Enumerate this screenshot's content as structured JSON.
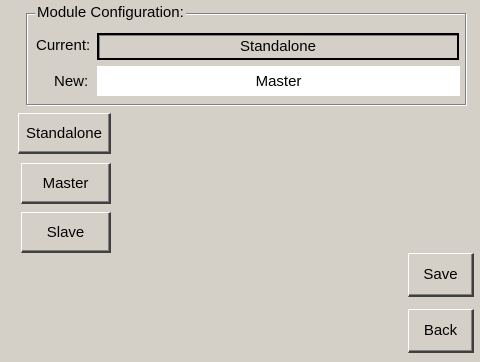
{
  "module_config": {
    "group_title": "Module Configuration:",
    "current_label": "Current:",
    "current_value": "Standalone",
    "new_label": "New:",
    "new_value": "Master"
  },
  "mode_buttons": {
    "standalone": "Standalone",
    "master": "Master",
    "slave": "Slave"
  },
  "actions": {
    "save": "Save",
    "back": "Back"
  }
}
